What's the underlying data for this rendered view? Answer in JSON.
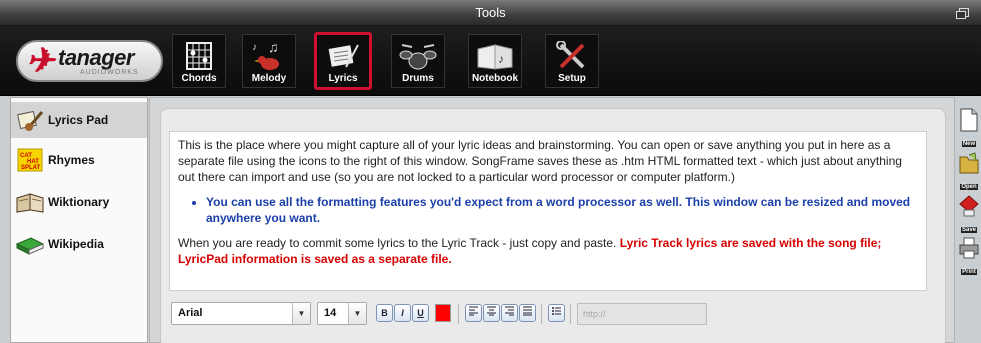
{
  "window": {
    "title": "Tools"
  },
  "logo": {
    "name": "tanager",
    "subtitle": "AUDIOWORKS"
  },
  "toolbar": {
    "tools": [
      {
        "label": "Chords",
        "icon": "chord-grid-icon",
        "active": false
      },
      {
        "label": "Melody",
        "icon": "bird-notes-icon",
        "active": false
      },
      {
        "label": "Lyrics",
        "icon": "lyrics-pad-icon",
        "active": true
      },
      {
        "label": "Drums",
        "icon": "drum-kit-icon",
        "active": false
      },
      {
        "label": "Notebook",
        "icon": "notebook-icon",
        "active": false
      },
      {
        "label": "Setup",
        "icon": "tools-icon",
        "active": false
      }
    ]
  },
  "sidebar": {
    "items": [
      {
        "label": "Lyrics Pad",
        "icon": "notepad-guitar-icon",
        "selected": true
      },
      {
        "label": "Rhymes",
        "icon": "rhymes-sticky-icon",
        "selected": false
      },
      {
        "label": "Wiktionary",
        "icon": "book-icon",
        "selected": false
      },
      {
        "label": "Wikipedia",
        "icon": "green-book-icon",
        "selected": false
      }
    ]
  },
  "editor": {
    "para1": "This is the place where you might capture all of your lyric ideas and brainstorming.  You can open or save anything you put in here as a separate file using the icons to the right of this window.  SongFrame saves these as .htm HTML formatted text - which just about anything out there can import and use (so you are not locked to a particular word processor or computer platform.)",
    "bullet": "You can use all the formatting features you'd expect from a word processor as well. This window can be resized and moved anywhere you want.",
    "para3_plain": "When you are ready to commit some lyrics to the Lyric Track - just copy and paste.  ",
    "para3_red": "Lyric Track lyrics are saved with the song file; LyricPad information is saved as a separate file.",
    "bullet_color": "#1a3fa8",
    "highlight_color": "#d60000"
  },
  "format": {
    "font": "Arial",
    "size": "14",
    "bold": "B",
    "italic": "I",
    "underline": "U",
    "text_color": "#ff0000",
    "url_placeholder": "http://"
  },
  "actions": [
    {
      "label": "New",
      "icon": "new-file-icon"
    },
    {
      "label": "Open",
      "icon": "open-folder-icon"
    },
    {
      "label": "Save",
      "icon": "save-icon"
    },
    {
      "label": "Print",
      "icon": "print-icon"
    }
  ]
}
